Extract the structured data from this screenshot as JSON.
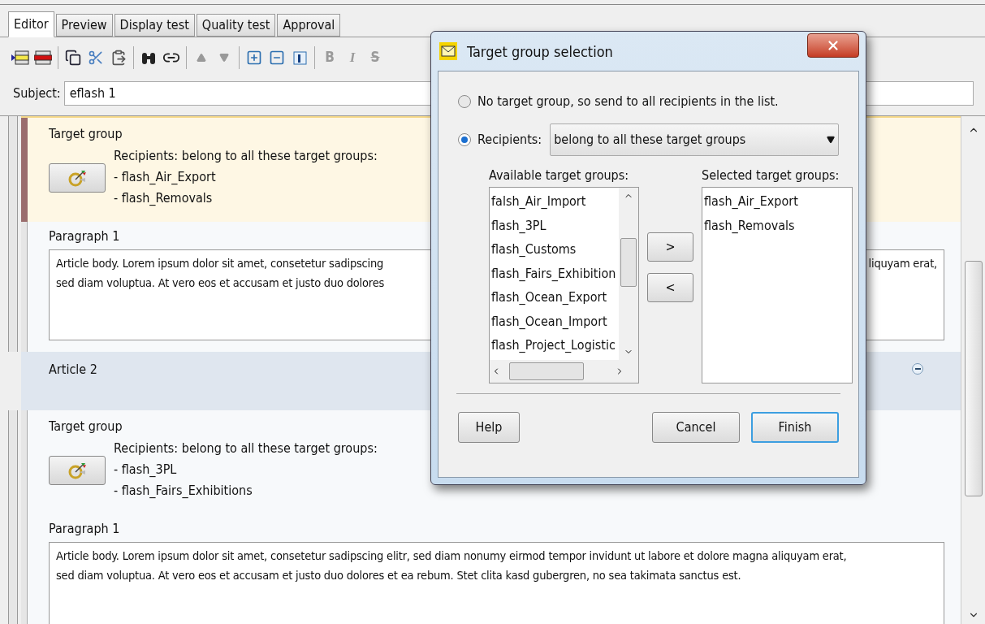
{
  "tabs": [
    {
      "label": "Editor",
      "selected": true
    },
    {
      "label": "Preview",
      "selected": false
    },
    {
      "label": "Display test",
      "selected": false
    },
    {
      "label": "Quality test",
      "selected": false
    },
    {
      "label": "Approval",
      "selected": false
    }
  ],
  "toolbar": {
    "format_buttons": [
      {
        "label": "B",
        "disabled": true
      },
      {
        "label": "I",
        "disabled": true
      },
      {
        "label": "S",
        "disabled": true
      }
    ]
  },
  "subject": {
    "label": "Subject:",
    "value": "eflash 1"
  },
  "articles": [
    {
      "target_group": {
        "label": "Target group",
        "selected": true,
        "summary": "Recipients: belong to all these target groups:",
        "groups": [
          "- flash_Air_Export",
          "- flash_Removals"
        ]
      },
      "paragraph": {
        "label": "Paragraph 1",
        "lines": [
          "Article body. Lorem ipsum dolor sit amet, consetetur sadipscing",
          "sed diam voluptua. At vero eos et accusam et justo duo dolores"
        ],
        "right_fragment": "liquyam erat,"
      }
    },
    {
      "header": "Article 2",
      "expanded": true,
      "target_group": {
        "label": "Target group",
        "selected": false,
        "summary": "Recipients: belong to all these target groups:",
        "groups": [
          "- flash_3PL",
          "- flash_Fairs_Exhibitions"
        ]
      },
      "paragraph": {
        "label": "Paragraph 1",
        "lines": [
          "Article body. Lorem ipsum dolor sit amet, consetetur sadipscing elitr, sed diam nonumy eirmod tempor invidunt ut labore et dolore magna aliquyam erat,",
          "sed diam voluptua. At vero eos et accusam et justo duo dolores et ea rebum. Stet clita kasd gubergren, no sea takimata sanctus est."
        ]
      }
    }
  ],
  "dialog": {
    "title": "Target group selection",
    "options": [
      {
        "label": "No target group, so send to all recipients in the list.",
        "selected": false
      },
      {
        "label": "Recipients:",
        "selected": true
      }
    ],
    "recipients_dropdown": "belong to all these target groups",
    "available": {
      "label": "Available target groups:",
      "items": [
        "falsh_Air_Import",
        "flash_3PL",
        "flash_Customs",
        "flash_Fairs_Exhibition",
        "flash_Ocean_Export",
        "flash_Ocean_Import",
        "flash_Project_Logistic"
      ]
    },
    "selected_list": {
      "label": "Selected target groups:",
      "items": [
        "flash_Air_Export",
        "flash_Removals"
      ]
    },
    "move_buttons": [
      ">",
      "<"
    ],
    "buttons": [
      {
        "label": "Help",
        "default": false
      },
      {
        "label": "Cancel",
        "default": false
      },
      {
        "label": "Finish",
        "default": true
      }
    ]
  }
}
